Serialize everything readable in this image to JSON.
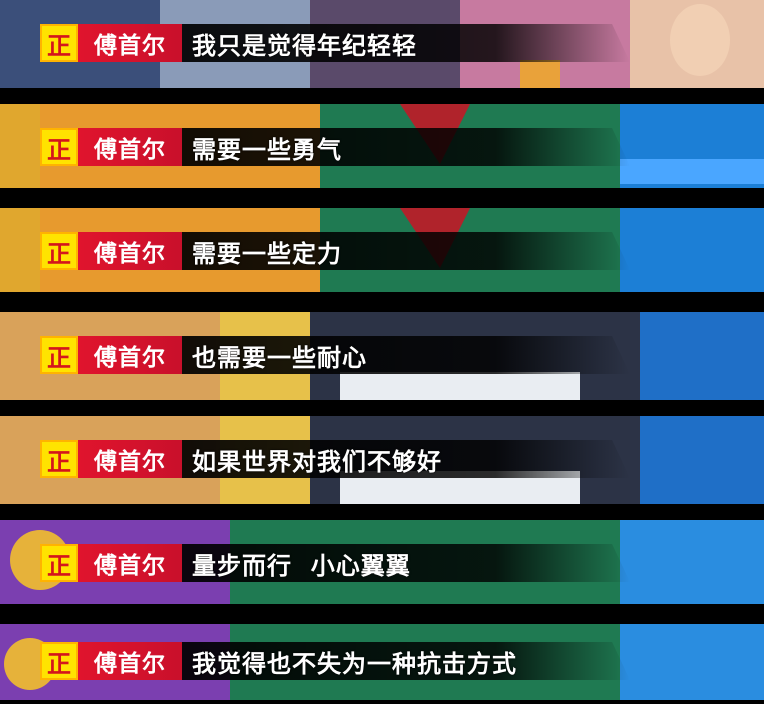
{
  "subtitle_tag": "正",
  "speaker": "傅首尔",
  "lines": [
    "我只是觉得年纪轻轻",
    "需要一些勇气",
    "需要一些定力",
    "也需要一些耐心",
    "如果世界对我们不够好",
    "量步而行  小心翼翼",
    "我觉得也不失为一种抗击方式"
  ],
  "colors": {
    "tag_bg": "#ffe300",
    "tag_text": "#d4141c",
    "speaker_bg": "#e0142d",
    "subtitle_text": "#ffffff"
  }
}
